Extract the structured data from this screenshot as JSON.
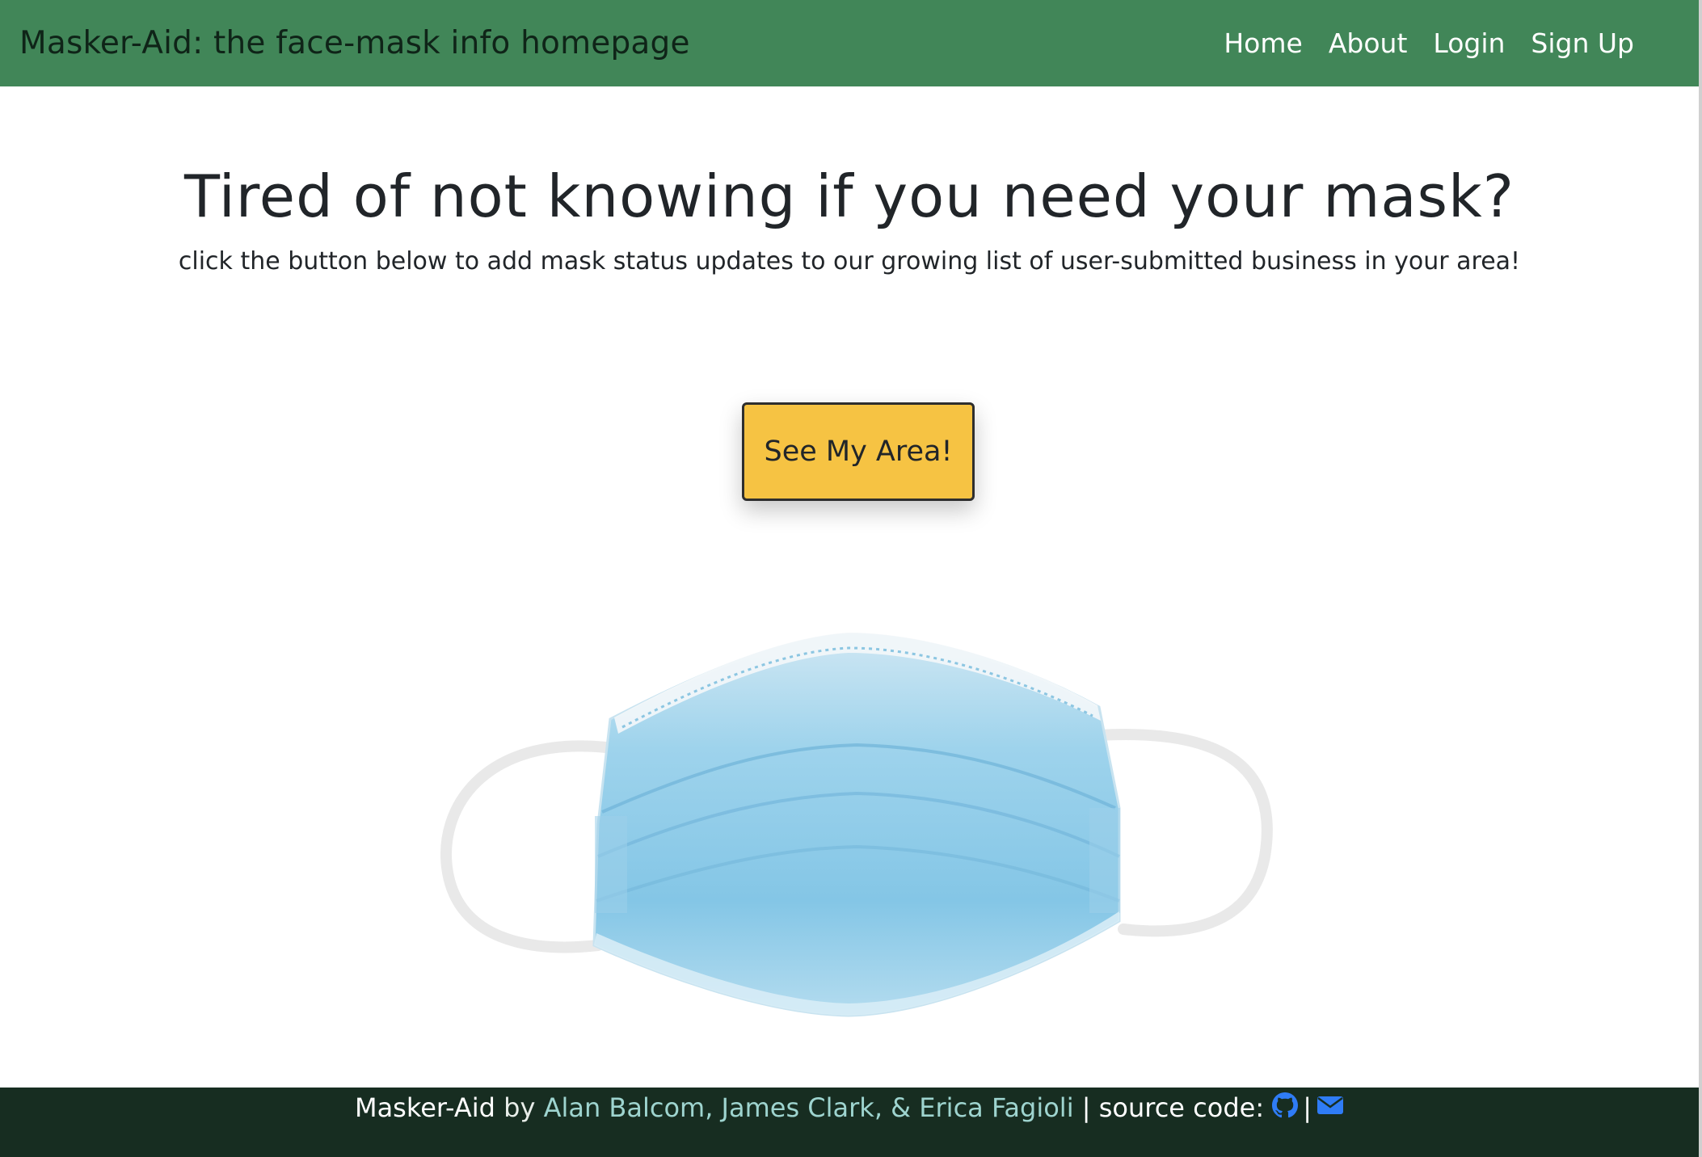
{
  "navbar": {
    "brand": "Masker-Aid: the face-mask info homepage",
    "links": [
      "Home",
      "About",
      "Login",
      "Sign Up"
    ]
  },
  "hero": {
    "title": "Tired of not knowing if you need your mask?",
    "subtitle": "click the button below to add mask status updates to our growing list of user-submitted business in your area!",
    "cta_label": "See My Area!"
  },
  "footer": {
    "app_name": "Masker-Aid",
    "by": "by",
    "authors": "Alan Balcom, James Clark, & Erica Fagioli",
    "pipe": "|",
    "source_label": "source code:",
    "pipe2": "|",
    "icons": [
      "github-icon",
      "envelope-icon"
    ]
  },
  "colors": {
    "navbar_bg": "#418658",
    "footer_bg": "#172d21",
    "cta_bg": "#f6c343",
    "footer_link": "#9ed4cf",
    "icon_blue": "#2f7cf6"
  }
}
